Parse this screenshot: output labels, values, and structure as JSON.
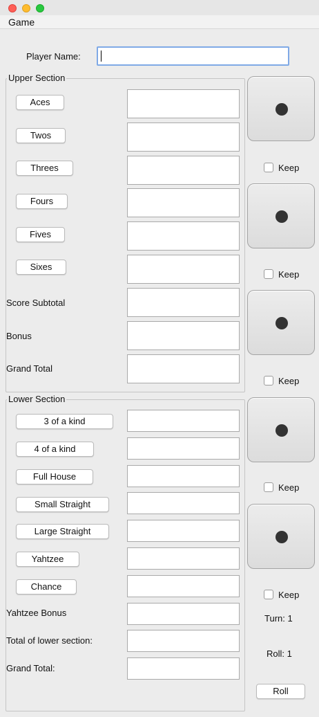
{
  "menu": {
    "game": "Game"
  },
  "player": {
    "label": "Player Name:",
    "value": ""
  },
  "upper": {
    "title": "Upper Section",
    "buttons": [
      "Aces",
      "Twos",
      "Threes",
      "Fours",
      "Fives",
      "Sixes"
    ],
    "labels": [
      "Score Subtotal",
      "Bonus",
      "Grand Total"
    ]
  },
  "lower": {
    "title": "Lower Section",
    "buttons": [
      "3 of a kind",
      "4 of a kind",
      "Full House",
      "Small Straight",
      "Large Straight",
      "Yahtzee",
      "Chance"
    ],
    "labels": [
      "Yahtzee Bonus",
      "Total of lower section:",
      "Grand Total:"
    ]
  },
  "dice": {
    "values": [
      1,
      1,
      1,
      1,
      1
    ],
    "keep_label": "Keep"
  },
  "status": {
    "turn": "Turn: 1",
    "roll": "Roll: 1"
  },
  "roll_button": "Roll",
  "colors": {
    "focus_border": "#7fa9e6",
    "pip": "#333333"
  }
}
